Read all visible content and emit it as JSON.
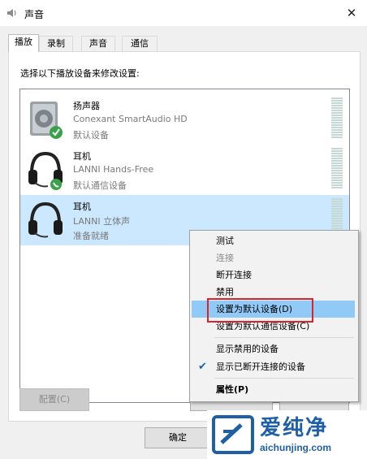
{
  "window": {
    "title": "声音"
  },
  "tabs": [
    "播放",
    "录制",
    "声音",
    "通信"
  ],
  "instruction": "选择以下播放设备来修改设置:",
  "devices": [
    {
      "name": "扬声器",
      "driver": "Conexant SmartAudio HD",
      "status": "默认设备"
    },
    {
      "name": "耳机",
      "driver": "LANNI Hands-Free",
      "status": "默认通信设备"
    },
    {
      "name": "耳机",
      "driver": "LANNI 立体声",
      "status": "准备就绪"
    }
  ],
  "buttons": {
    "configure": "配置(C)",
    "ok": "确定"
  },
  "context_menu": {
    "items": [
      "测试",
      "连接",
      "断开连接",
      "禁用",
      "设置为默认设备(D)",
      "设置为默认通信设备(C)",
      "显示禁用的设备",
      "显示已断开连接的设备",
      "属性(P)"
    ]
  },
  "watermark": {
    "cn": "爱纯净",
    "en": "aichunjing.com"
  },
  "colors": {
    "accent": "#cce8ff",
    "highlight": "#91c9f7",
    "annotation": "#d9232d",
    "watermark": "#1f5fa8"
  }
}
